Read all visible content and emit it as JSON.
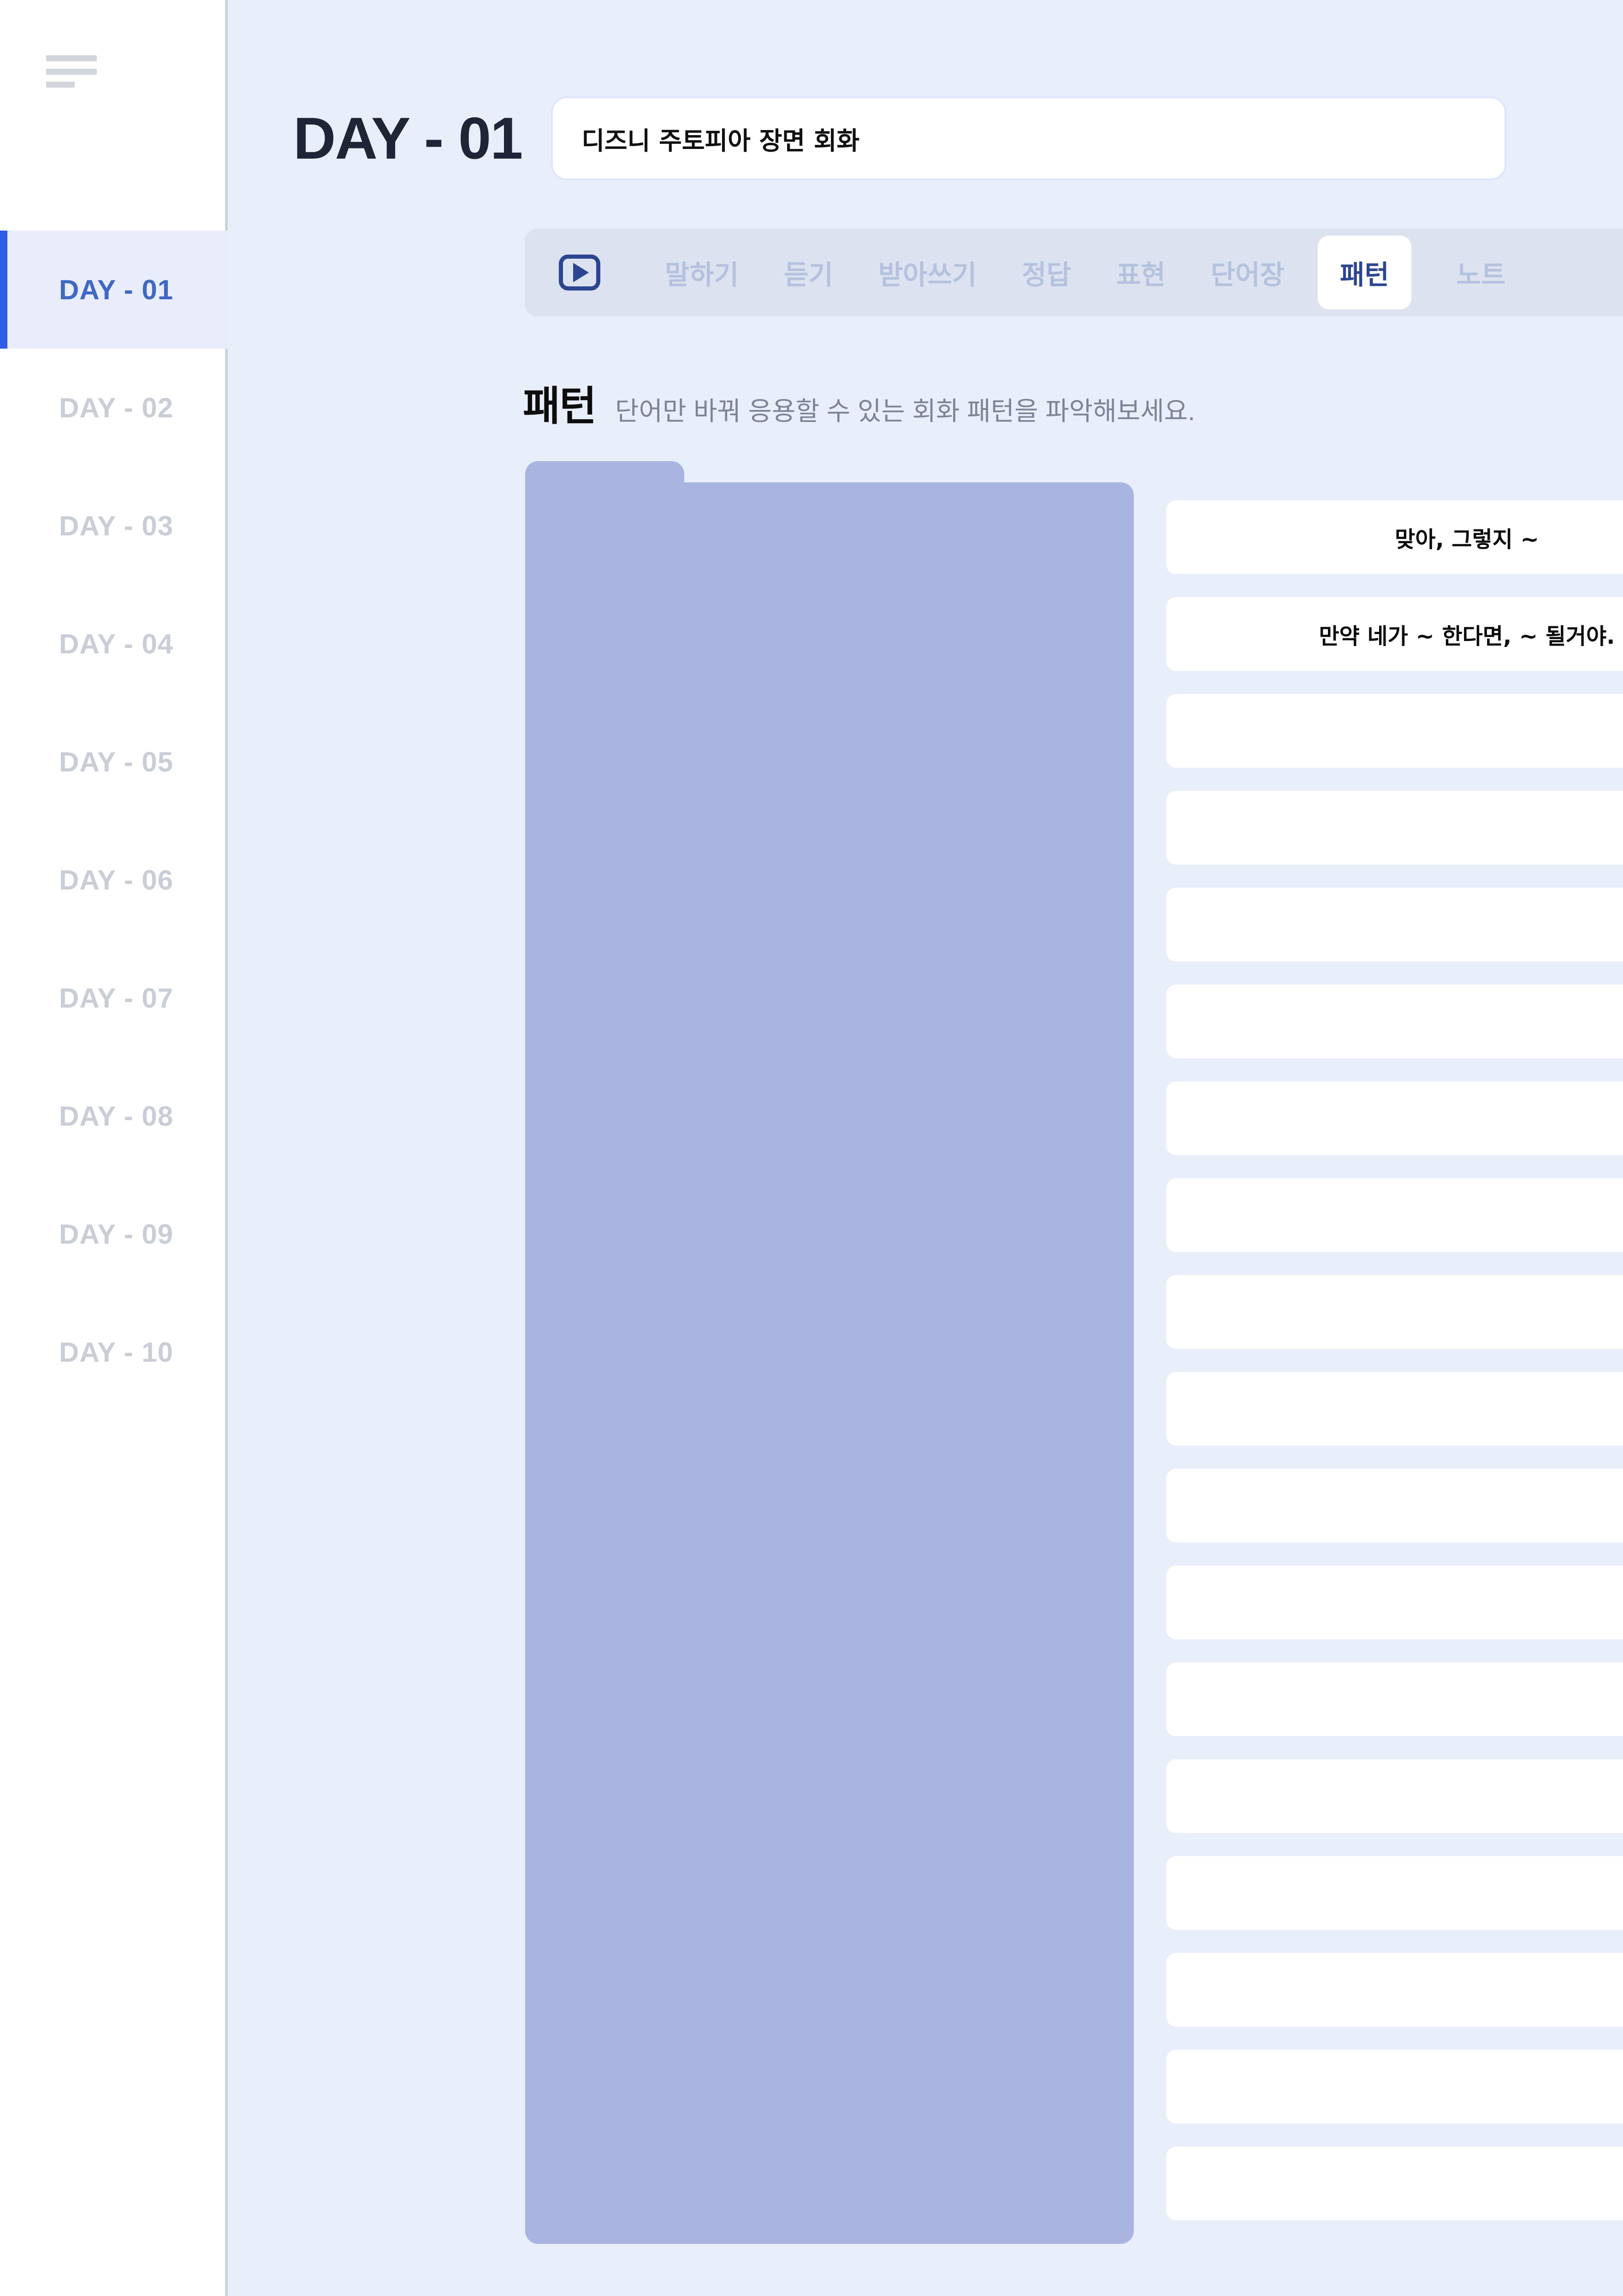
{
  "sidebar": {
    "menu_icon": "hamburger-icon",
    "items": [
      {
        "label": "DAY - 01",
        "active": true
      },
      {
        "label": "DAY - 02",
        "active": false
      },
      {
        "label": "DAY - 03",
        "active": false
      },
      {
        "label": "DAY - 04",
        "active": false
      },
      {
        "label": "DAY - 05",
        "active": false
      },
      {
        "label": "DAY - 06",
        "active": false
      },
      {
        "label": "DAY - 07",
        "active": false
      },
      {
        "label": "DAY - 08",
        "active": false
      },
      {
        "label": "DAY - 09",
        "active": false
      },
      {
        "label": "DAY - 10",
        "active": false
      }
    ]
  },
  "header": {
    "title": "DAY - 01",
    "lesson_title_value": "디즈니 주토피아 장면 회화",
    "lesson_title_placeholder": "디즈니 주토피아 장면 회화"
  },
  "tabbar": {
    "play_icon": "play-video-icon",
    "tabs": [
      {
        "label": "말하기",
        "active": false
      },
      {
        "label": "듣기",
        "active": false
      },
      {
        "label": "받아쓰기",
        "active": false
      },
      {
        "label": "정답",
        "active": false
      },
      {
        "label": "표현",
        "active": false
      },
      {
        "label": "단어장",
        "active": false
      },
      {
        "label": "패턴",
        "active": true
      },
      {
        "label": "노트",
        "active": false
      }
    ]
  },
  "section": {
    "title": "패턴",
    "subtitle": "단어만 바꿔 응용할 수 있는 회화 패턴을 파악해보세요."
  },
  "pattern_cards": [
    {
      "text": "맞아, 그렇지 ~"
    },
    {
      "text": "만약 네가 ~ 한다면, ~ 될거야."
    },
    {
      "text": ""
    },
    {
      "text": ""
    },
    {
      "text": ""
    },
    {
      "text": ""
    },
    {
      "text": ""
    },
    {
      "text": ""
    },
    {
      "text": ""
    },
    {
      "text": ""
    },
    {
      "text": ""
    },
    {
      "text": ""
    },
    {
      "text": ""
    },
    {
      "text": ""
    },
    {
      "text": ""
    },
    {
      "text": ""
    },
    {
      "text": ""
    },
    {
      "text": ""
    }
  ],
  "colors": {
    "background": "#e8eefa",
    "sidebar_bg": "#ffffff",
    "active_accent": "#2f5de8",
    "active_text": "#4068c4",
    "inactive_nav_text": "#c9cdd6",
    "tabbar_bg": "#dce2f0",
    "tab_inactive_text": "#b4c2de",
    "tab_active_text": "#2c4590",
    "folder_panel": "#a9b5e0",
    "card_bg": "#ffffff",
    "title_text": "#1d2536",
    "subtitle_text": "#7b8598"
  }
}
